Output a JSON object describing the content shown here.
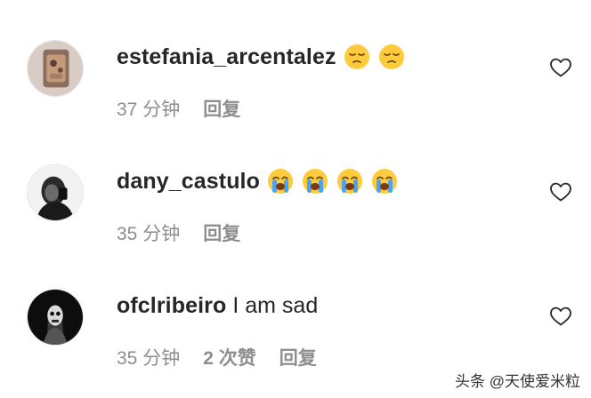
{
  "comments": [
    {
      "username": "estefania_arcentalez",
      "text": "",
      "emojis": [
        "pensive-face",
        "pensive-face"
      ],
      "time": "37 分钟",
      "likes": "",
      "reply_label": "回复"
    },
    {
      "username": "dany_castulo",
      "text": "",
      "emojis": [
        "loudly-crying-face",
        "loudly-crying-face",
        "loudly-crying-face",
        "loudly-crying-face"
      ],
      "time": "35 分钟",
      "likes": "",
      "reply_label": "回复"
    },
    {
      "username": "ofclribeiro",
      "text": "I am sad",
      "emojis": [],
      "time": "35 分钟",
      "likes": "2 次赞",
      "reply_label": "回复"
    }
  ],
  "icons": {
    "like": "heart-outline-icon"
  },
  "colors": {
    "username": "#262626",
    "meta": "#8e8e8e",
    "background": "#ffffff",
    "emoji_face": "#ffcb3d",
    "tear": "#4aa3f0"
  },
  "watermark": "头条 @天使爱米粒"
}
